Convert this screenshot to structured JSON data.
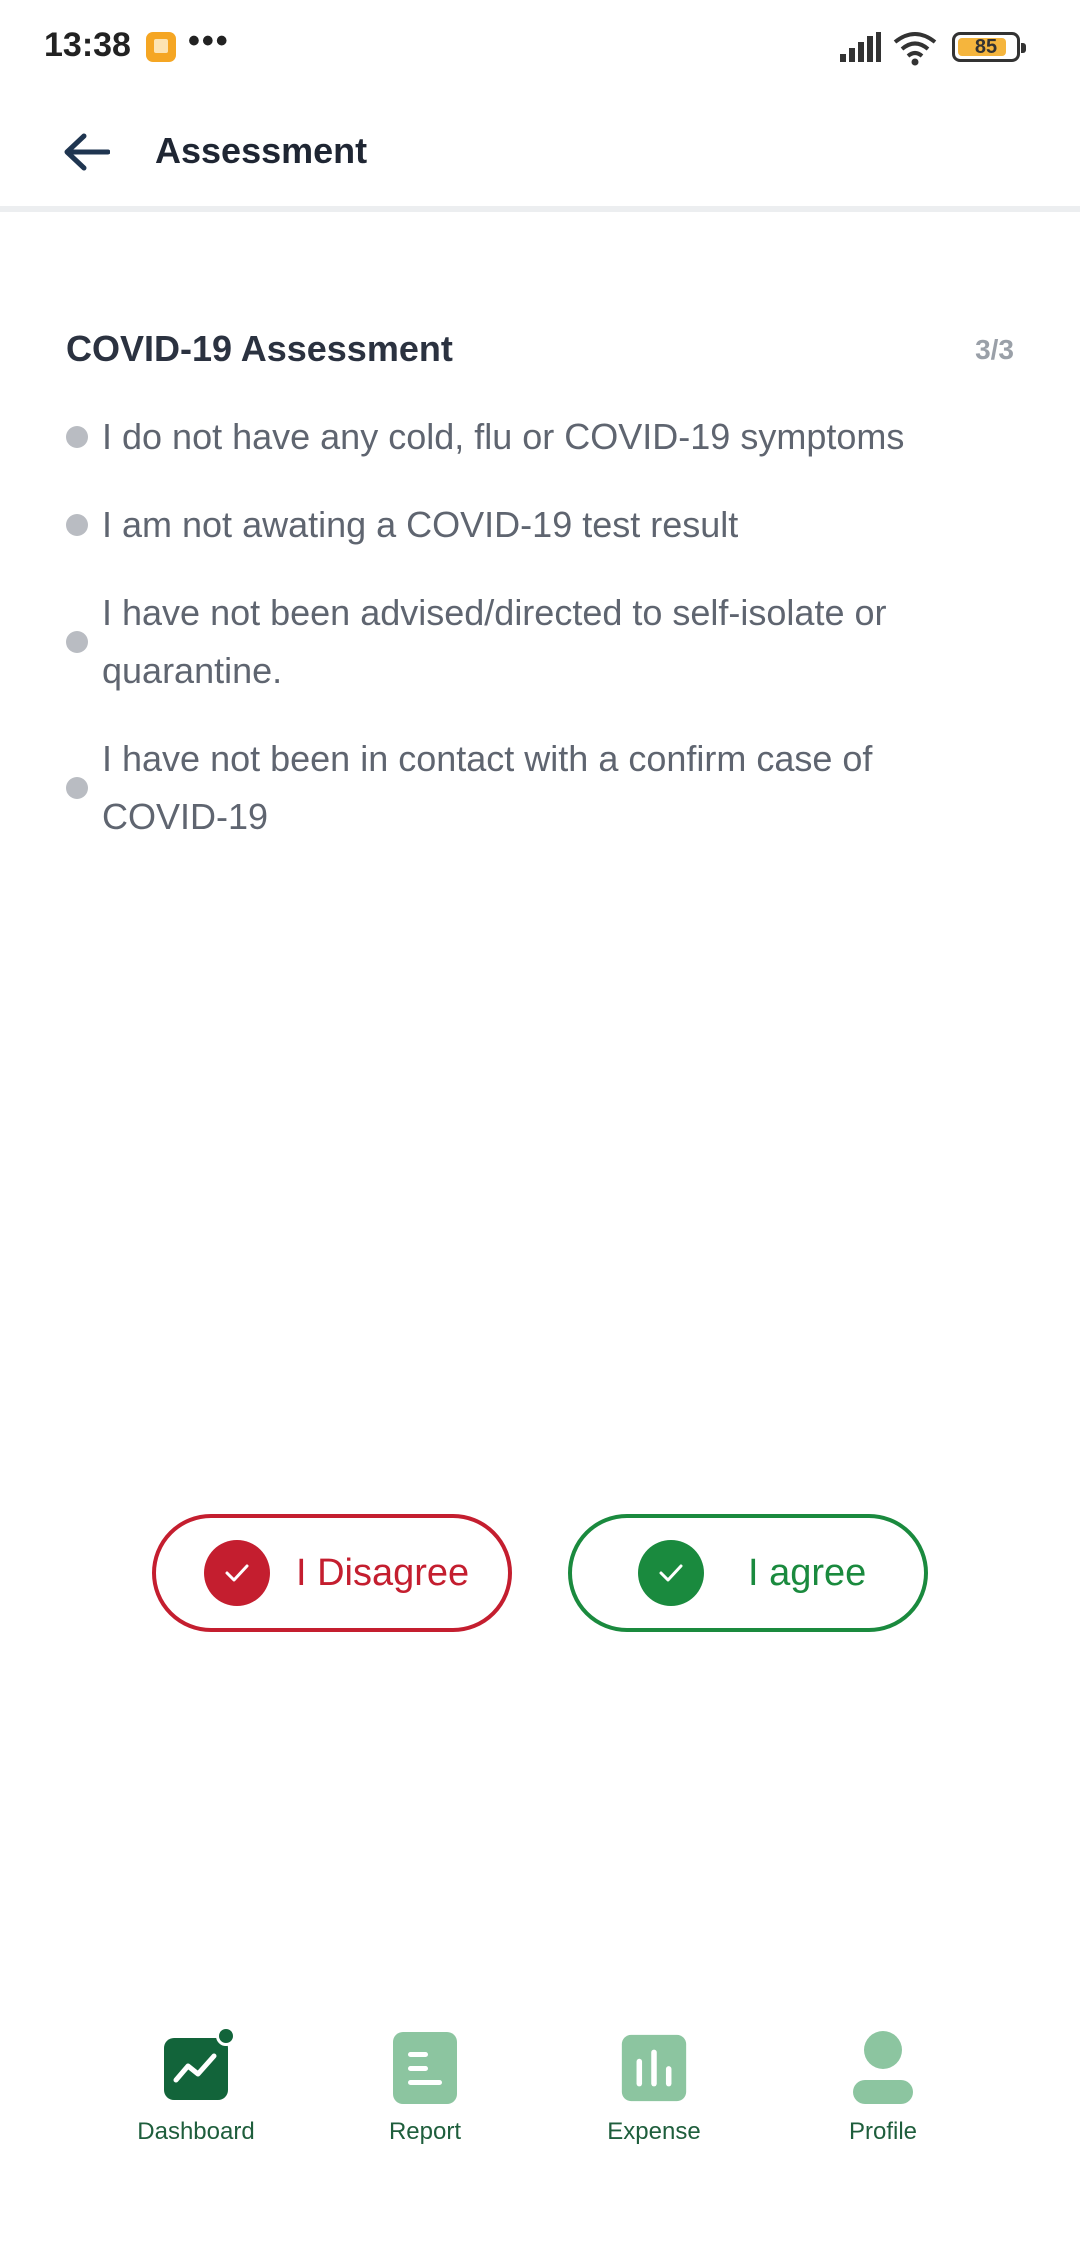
{
  "status_bar": {
    "time": "13:38",
    "dots": "•••",
    "battery_level": "85",
    "battery_fraction": 0.85
  },
  "header": {
    "title": "Assessment",
    "back_icon": "arrow-left-icon"
  },
  "assessment": {
    "title": "COVID-19 Assessment",
    "step": "3/3",
    "statements": [
      "I do not have any cold, flu or COVID-19 symptoms",
      "I am not awating a COVID-19 test result",
      "I have not been advised/directed to self-isolate or quarantine.",
      "I have not been in contact with a confirm case of COVID-19"
    ]
  },
  "buttons": {
    "disagree_label": "I Disagree",
    "agree_label": "I agree",
    "disagree_color": "#c41e2f",
    "agree_color": "#1a8a3e"
  },
  "bottom_nav": {
    "items": [
      {
        "label": "Dashboard",
        "icon": "dashboard-chart-icon",
        "active": true
      },
      {
        "label": "Report",
        "icon": "report-icon",
        "active": false
      },
      {
        "label": "Expense",
        "icon": "expense-bars-icon",
        "active": false
      },
      {
        "label": "Profile",
        "icon": "profile-icon",
        "active": false
      }
    ],
    "active_color": "#12643a",
    "inactive_color": "#8cc5a0"
  }
}
